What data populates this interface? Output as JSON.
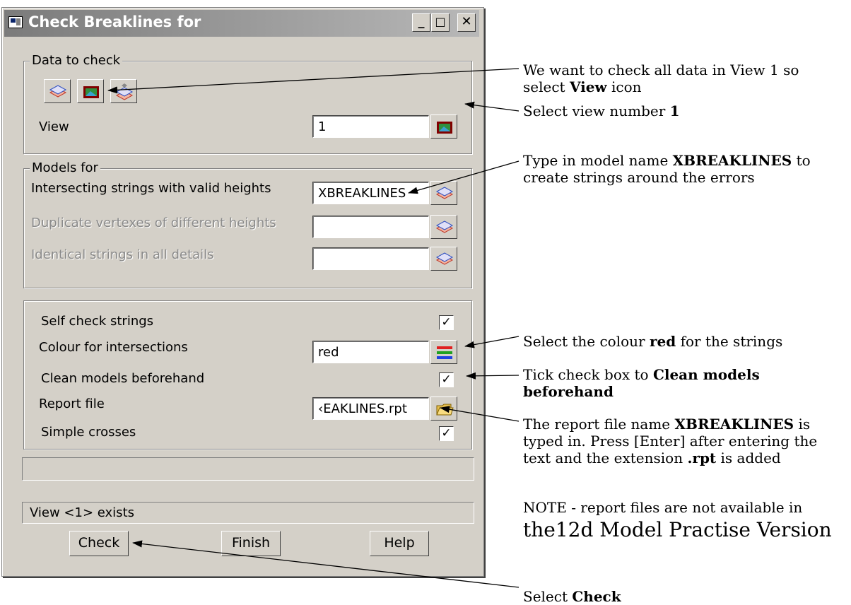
{
  "window": {
    "title": "Check Breaklines for",
    "minimize": "_",
    "maximize": "□",
    "close": "✕"
  },
  "data_to_check": {
    "group_label": "Data to check",
    "view_label": "View",
    "view_value": "1"
  },
  "models_for": {
    "group_label": "Models for",
    "rows": [
      {
        "label": "Intersecting strings with valid heights",
        "value": "XBREAKLINES",
        "enabled": true
      },
      {
        "label": "Duplicate vertexes of different heights",
        "value": "",
        "enabled": false
      },
      {
        "label": "Identical strings in all details",
        "value": "",
        "enabled": false
      }
    ]
  },
  "options": {
    "self_check_label": "Self check strings",
    "self_check_checked": true,
    "colour_label": "Colour for intersections",
    "colour_value": "red",
    "clean_label": "Clean models beforehand",
    "clean_checked": true,
    "report_label": "Report file",
    "report_value": "‹EAKLINES.rpt",
    "simple_label": "Simple crosses",
    "simple_checked": true
  },
  "status": {
    "progress_text": "",
    "message": "View <1> exists"
  },
  "buttons": {
    "check": "Check",
    "finish": "Finish",
    "help": "Help"
  },
  "annotations": {
    "view_icon_1": "We want to check all data in View 1 so",
    "view_icon_2a": "select ",
    "view_icon_2b": "View",
    "view_icon_2c": " icon",
    "view_number_a": "Select view number ",
    "view_number_b": "1",
    "model_name_1a": "Type in model name ",
    "model_name_1b": "XBREAKLINES",
    "model_name_1c": " to",
    "model_name_2": "create strings around the errors",
    "colour_a": "Select the colour ",
    "colour_b": "red",
    "colour_c": " for the strings",
    "clean_1a": "Tick check box to ",
    "clean_1b": "Clean models",
    "clean_2": "beforehand",
    "report_1a": "The report file name ",
    "report_1b": "XBREAKLINES",
    "report_1c": " is",
    "report_2": "typed in. Press [Enter] after entering the",
    "report_3a": "text and the extension ",
    "report_3b": ".rpt",
    "report_3c": " is added",
    "note_1": "NOTE - report files are not available in",
    "note_2": "the12d Model Practise Version",
    "check_a": "Select ",
    "check_b": "Check"
  },
  "colors": {
    "dialog_bg": "#d4d0c8",
    "titlebar": "#7b7b7b",
    "arrow": "#000000"
  }
}
